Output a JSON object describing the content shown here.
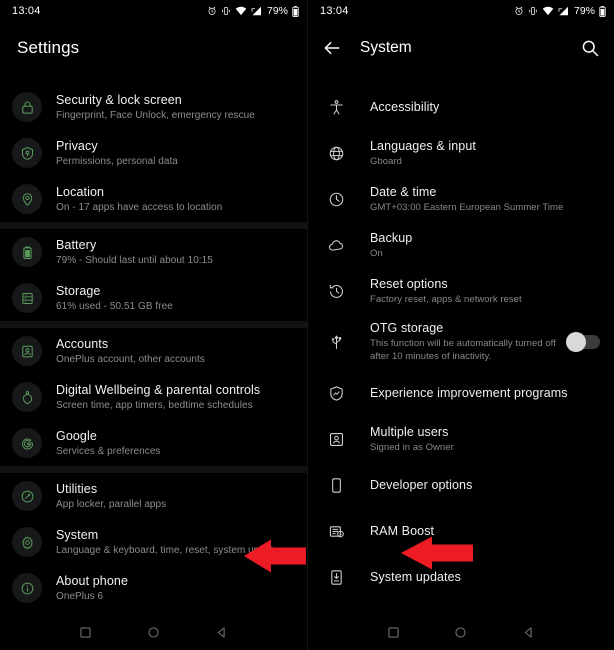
{
  "status": {
    "time": "13:04",
    "battery_percent": "79%",
    "icons": [
      "alarm-icon",
      "vibrate-icon",
      "wifi-icon",
      "signal-icon",
      "battery-icon"
    ]
  },
  "left_screen": {
    "header": {
      "title": "Settings"
    },
    "groups": [
      {
        "items": [
          {
            "icon": "lock-icon",
            "title": "Security & lock screen",
            "subtitle": "Fingerprint, Face Unlock, emergency rescue"
          },
          {
            "icon": "privacy-icon",
            "title": "Privacy",
            "subtitle": "Permissions, personal data"
          },
          {
            "icon": "location-pin-icon",
            "title": "Location",
            "subtitle": "On - 17 apps have access to location"
          }
        ]
      },
      {
        "items": [
          {
            "icon": "battery-icon",
            "title": "Battery",
            "subtitle": "79% - Should last until about 10:15"
          },
          {
            "icon": "storage-icon",
            "title": "Storage",
            "subtitle": "61% used - 50.51 GB free"
          }
        ]
      },
      {
        "items": [
          {
            "icon": "account-icon",
            "title": "Accounts",
            "subtitle": "OnePlus account, other accounts"
          },
          {
            "icon": "wellbeing-icon",
            "title": "Digital Wellbeing & parental controls",
            "subtitle": "Screen time, app timers, bedtime schedules"
          },
          {
            "icon": "google-icon",
            "title": "Google",
            "subtitle": "Services & preferences"
          }
        ]
      },
      {
        "items": [
          {
            "icon": "utilities-icon",
            "title": "Utilities",
            "subtitle": "App locker, parallel apps"
          },
          {
            "icon": "gear-icon",
            "title": "System",
            "subtitle": "Language & keyboard, time, reset, system updates"
          },
          {
            "icon": "info-icon",
            "title": "About phone",
            "subtitle": "OnePlus 6"
          }
        ]
      }
    ],
    "annotation": {
      "type": "red-arrow",
      "points_to": "System",
      "color": "#ed1b24"
    }
  },
  "right_screen": {
    "header": {
      "back": "back-arrow-icon",
      "title": "System",
      "search": "search-icon"
    },
    "items": [
      {
        "icon": "accessibility-icon",
        "title": "Accessibility",
        "subtitle": ""
      },
      {
        "icon": "globe-icon",
        "title": "Languages & input",
        "subtitle": "Gboard"
      },
      {
        "icon": "clock-icon",
        "title": "Date & time",
        "subtitle": "GMT+03:00 Eastern European Summer Time"
      },
      {
        "icon": "cloud-icon",
        "title": "Backup",
        "subtitle": "On"
      },
      {
        "icon": "restore-icon",
        "title": "Reset options",
        "subtitle": "Factory reset, apps & network reset"
      },
      {
        "icon": "usb-icon",
        "title": "OTG storage",
        "subtitle": "This function will be automatically turned off after 10 minutes of inactivity.",
        "toggle": "off"
      },
      {
        "icon": "shield-chart-icon",
        "title": "Experience improvement programs",
        "subtitle": ""
      },
      {
        "icon": "user-box-icon",
        "title": "Multiple users",
        "subtitle": "Signed in as Owner"
      },
      {
        "icon": "phone-icon",
        "title": "Developer options",
        "subtitle": ""
      },
      {
        "icon": "ram-icon",
        "title": "RAM Boost",
        "subtitle": ""
      },
      {
        "icon": "update-icon",
        "title": "System updates",
        "subtitle": ""
      }
    ],
    "annotation": {
      "type": "red-arrow",
      "points_to": "System updates",
      "color": "#ed1b24"
    }
  },
  "navbar": {
    "recents": "square-icon",
    "home": "circle-icon",
    "back": "triangle-back-icon"
  },
  "colors": {
    "background": "#000000",
    "divider": "#111214",
    "icon_green": "#5a9b5a",
    "icon_circle_bg": "#17181a",
    "primary_text": "#f2f2f2",
    "secondary_text": "#8b8d90",
    "arrow_red": "#ed1b24",
    "nav_icon": "#6d6f72"
  }
}
